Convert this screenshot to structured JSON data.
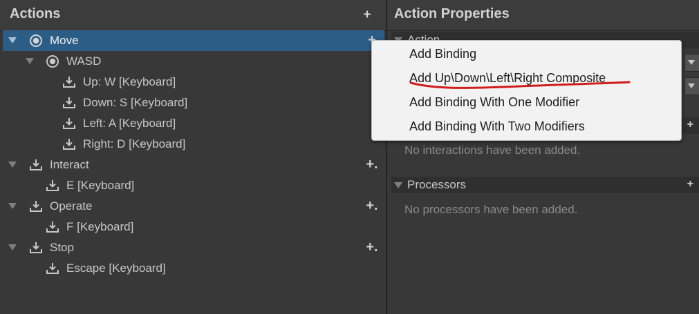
{
  "left_panel": {
    "title": "Actions",
    "add_label": "+",
    "rows": [
      {
        "label": "Move",
        "plus": "+",
        "selected": true
      },
      {
        "label": "WASD"
      },
      {
        "label": "Up: W [Keyboard]"
      },
      {
        "label": "Down: S [Keyboard]"
      },
      {
        "label": "Left: A [Keyboard]"
      },
      {
        "label": "Right: D [Keyboard]"
      },
      {
        "label": "Interact",
        "plus": "+."
      },
      {
        "label": "E [Keyboard]"
      },
      {
        "label": "Operate",
        "plus": "+."
      },
      {
        "label": "F [Keyboard]"
      },
      {
        "label": "Stop",
        "plus": "+."
      },
      {
        "label": "Escape [Keyboard]"
      }
    ]
  },
  "right_panel": {
    "title": "Action Properties",
    "action_section": {
      "label": "Action"
    },
    "interactions_section": {
      "add_label": "+",
      "empty": "No interactions have been added."
    },
    "processors_section": {
      "label": "Processors",
      "add_label": "+",
      "empty": "No processors have been added."
    }
  },
  "context_menu": {
    "items": [
      {
        "label": "Add Binding"
      },
      {
        "label": "Add Up\\Down\\Left\\Right Composite",
        "annotated": true
      },
      {
        "label": "Add Binding With One Modifier"
      },
      {
        "label": "Add Binding With Two Modifiers"
      }
    ]
  },
  "colors": {
    "background": "#383838",
    "selection": "#2c5d87",
    "menu_bg": "#f2f2f2",
    "annotation": "#d01c1c"
  },
  "icons": {
    "action": "download-tray-icon",
    "composite": "radio-target-icon",
    "binding": "download-tray-icon",
    "expand": "triangle-down-icon"
  }
}
